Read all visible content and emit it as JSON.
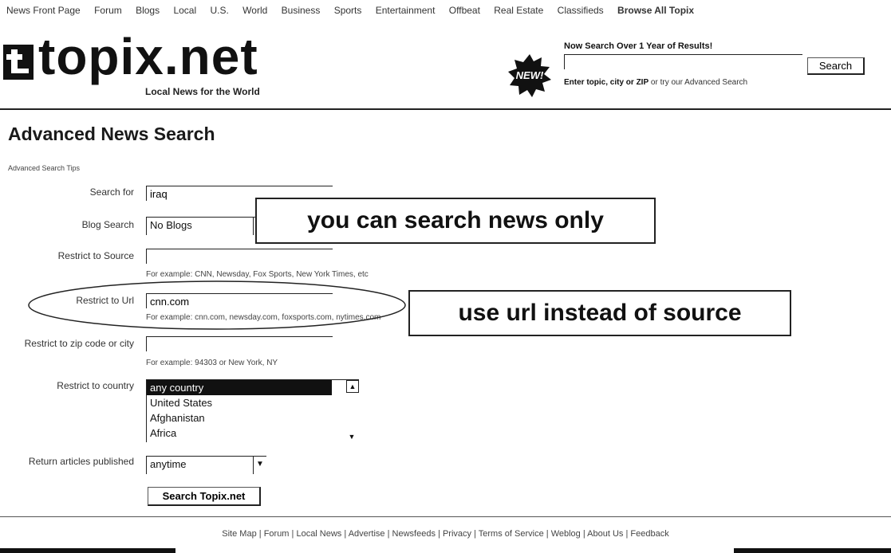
{
  "nav": {
    "items": [
      "News Front Page",
      "Forum",
      "Blogs",
      "Local",
      "U.S.",
      "World",
      "Business",
      "Sports",
      "Entertainment",
      "Offbeat",
      "Real Estate",
      "Classifieds"
    ],
    "browse_all": "Browse All Topix"
  },
  "logo": {
    "wordmark": "topix.net",
    "tagline": "Local News for the World"
  },
  "header_search": {
    "badge": "NEW!",
    "title": "Now Search Over 1 Year of Results!",
    "button": "Search",
    "hint_bold": "Enter topic, city or ZIP",
    "hint_rest": "or try our Advanced Search"
  },
  "page": {
    "title": "Advanced News Search",
    "tips_link": "Advanced Search Tips"
  },
  "form": {
    "search_for": {
      "label": "Search for",
      "value": "iraq"
    },
    "blog_search": {
      "label": "Blog Search",
      "value": "No Blogs"
    },
    "source": {
      "label": "Restrict to Source",
      "value": "",
      "help": "For example: CNN, Newsday, Fox Sports, New York Times, etc"
    },
    "url": {
      "label": "Restrict to Url",
      "value": "cnn.com",
      "help": "For example: cnn.com, newsday.com, foxsports.com, nytimes.com"
    },
    "zip": {
      "label": "Restrict to zip code or city",
      "value": "",
      "help": "For example: 94303 or New York, NY"
    },
    "country": {
      "label": "Restrict to country",
      "options": [
        "any country",
        "United States",
        "Afghanistan",
        "Africa"
      ],
      "selected": "any country"
    },
    "published": {
      "label": "Return articles published",
      "value": "anytime"
    },
    "submit": "Search Topix.net"
  },
  "annotations": {
    "news_only": "you can search news only",
    "use_url": "use url instead of source"
  },
  "footer": {
    "links": [
      "Site Map",
      "Forum",
      "Local News",
      "Advertise",
      "Newsfeeds",
      "Privacy",
      "Terms of Service",
      "Weblog",
      "About Us",
      "Feedback"
    ]
  }
}
